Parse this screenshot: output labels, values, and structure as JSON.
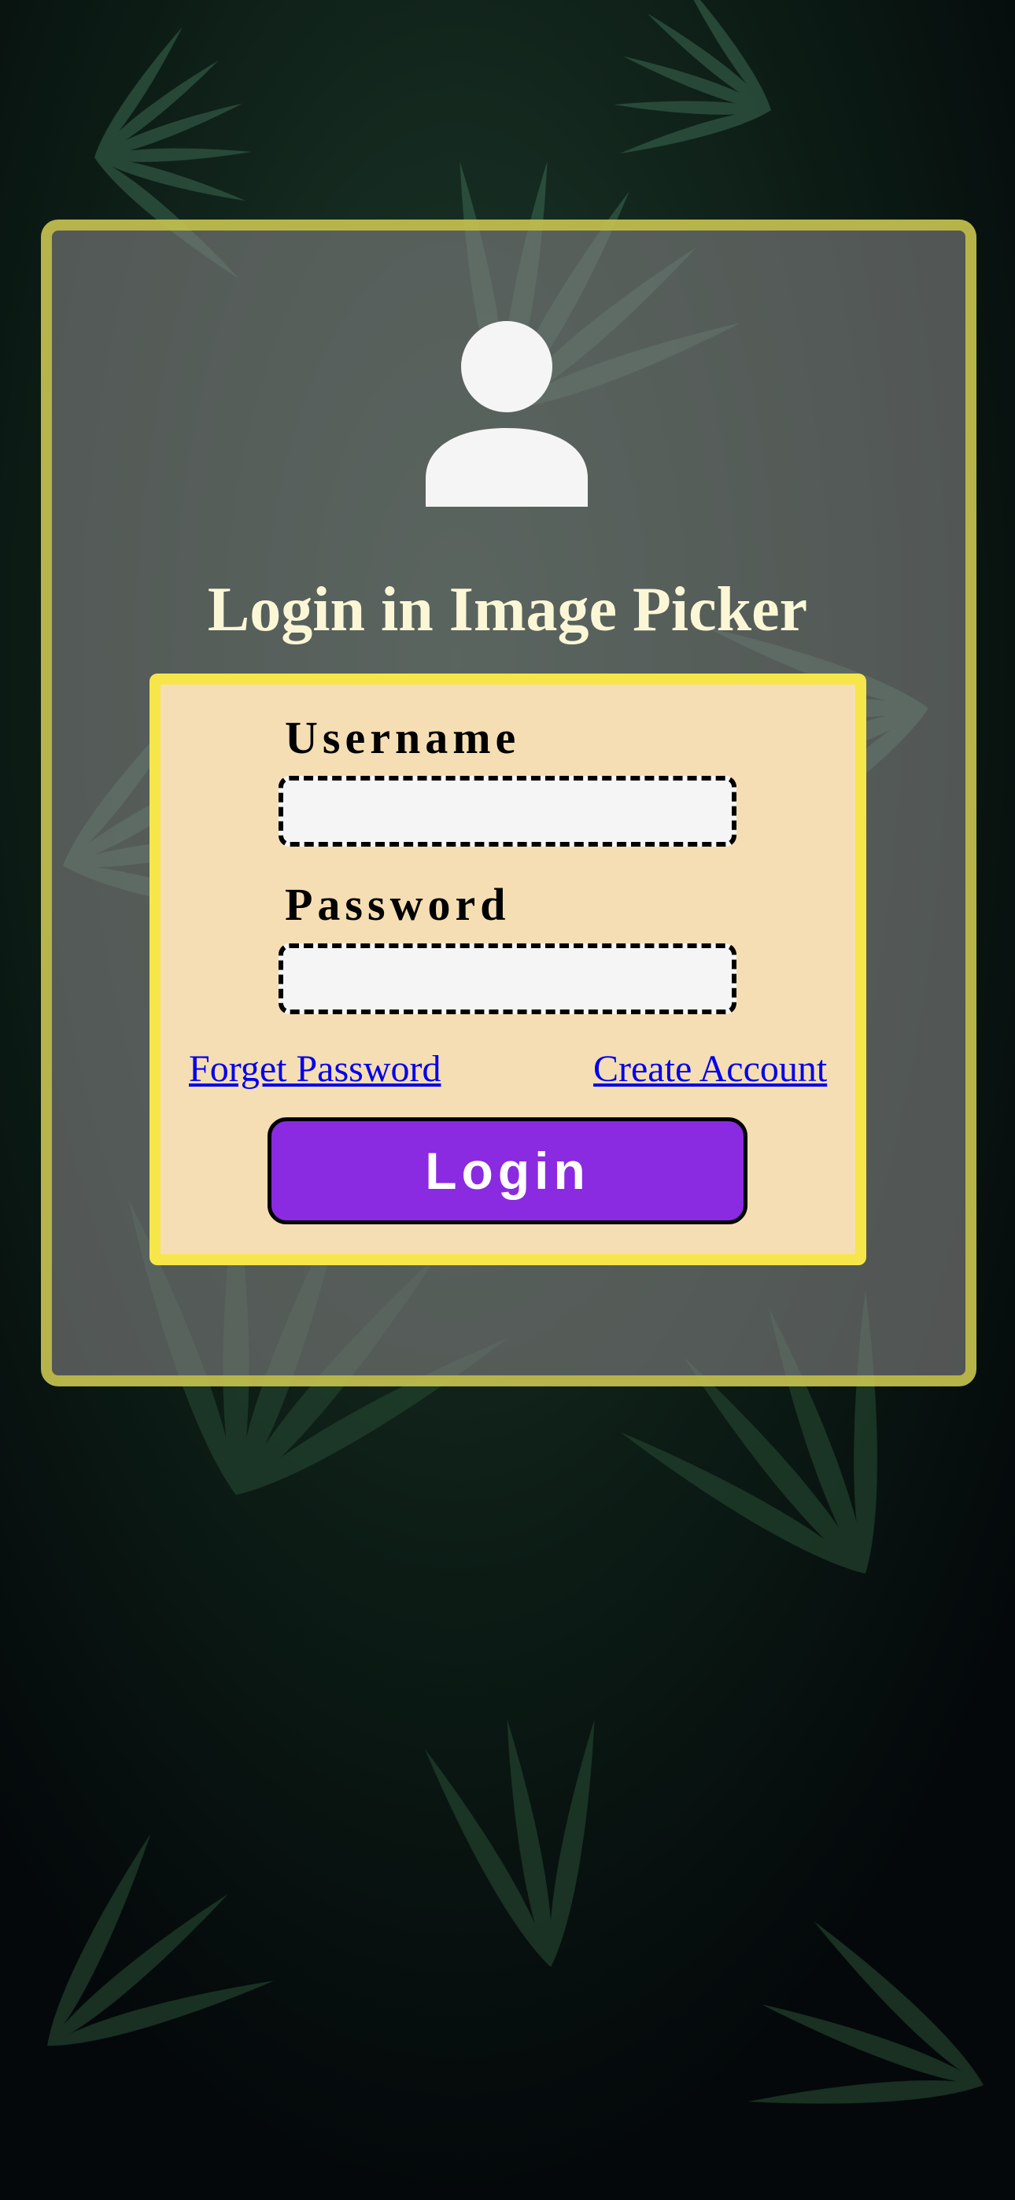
{
  "header": {
    "title": "Login in Image Picker"
  },
  "form": {
    "username_label": "Username",
    "username_value": "",
    "username_placeholder": "",
    "password_label": "Password",
    "password_value": "",
    "password_placeholder": "",
    "forget_password_link": "Forget Password",
    "create_account_link": "Create Account",
    "login_button": "Login"
  },
  "icons": {
    "avatar": "user-avatar-icon",
    "background": "palm-leaves-photo"
  },
  "colors": {
    "card_border": "#c8c448",
    "card_background": "#808080",
    "title_text": "#fbf7d6",
    "form_border": "#f7e64a",
    "form_background": "#f5deb3",
    "login_button": "#8a2be2",
    "link": "#0000ee"
  }
}
